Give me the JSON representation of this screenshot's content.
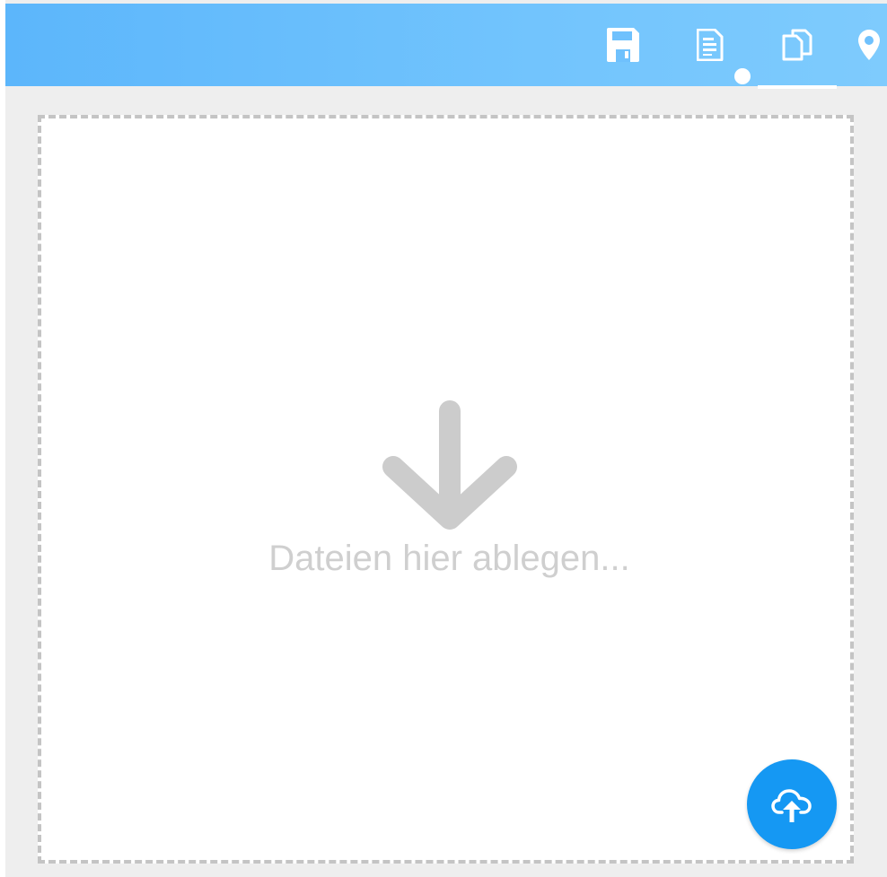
{
  "toolbar": {
    "buttons": [
      {
        "name": "save",
        "icon": "floppy-disk-icon"
      },
      {
        "name": "details",
        "icon": "document-icon"
      },
      {
        "name": "files",
        "icon": "copy-icon",
        "active": true
      },
      {
        "name": "location",
        "icon": "map-pin-icon"
      }
    ],
    "notification_dot": true
  },
  "dropzone": {
    "text": "Dateien hier ablegen...",
    "icon": "arrow-down-icon"
  },
  "upload_button": {
    "icon": "cloud-upload-icon"
  },
  "colors": {
    "toolbar": "#6fc1fd",
    "background": "#eeeeee",
    "dropzone_border": "#c4c4c4",
    "dropzone_text": "#cfcfcf",
    "fab": "#1598f3",
    "icon": "#ffffff"
  }
}
